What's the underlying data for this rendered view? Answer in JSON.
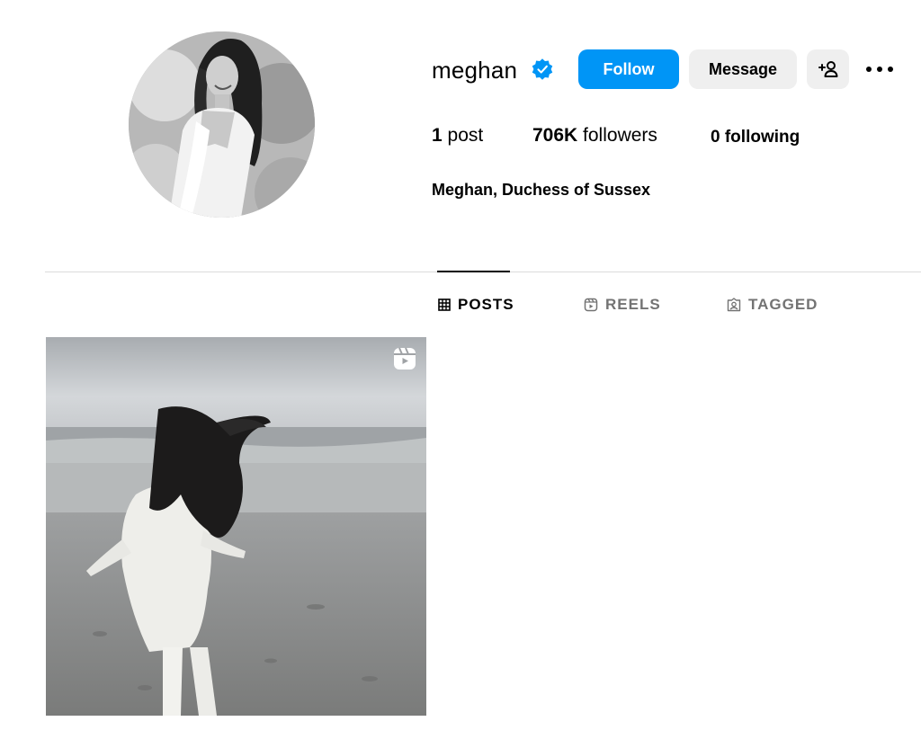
{
  "profile": {
    "username": "meghan",
    "verified": true,
    "full_name": "Meghan, Duchess of Sussex",
    "avatar_icon": "profile-photo"
  },
  "actions": {
    "follow_label": "Follow",
    "message_label": "Message",
    "add_user_icon": "person-plus-icon",
    "more_icon": "ellipsis-icon"
  },
  "stats": {
    "posts_count": "1",
    "posts_label": "post",
    "followers_count": "706K",
    "followers_label": "followers",
    "following_count": "0",
    "following_label": "following"
  },
  "tabs": [
    {
      "label": "POSTS",
      "icon": "grid-icon",
      "active": true
    },
    {
      "label": "REELS",
      "icon": "reels-icon",
      "active": false
    },
    {
      "label": "TAGGED",
      "icon": "tagged-icon",
      "active": false
    }
  ],
  "posts": [
    {
      "type": "reel",
      "badge_icon": "reels-icon"
    }
  ],
  "colors": {
    "accent": "#0095f6",
    "secondary_button": "#efefef",
    "muted_text": "#737373",
    "divider": "#dbdbdb",
    "verified_badge": "#0095f6"
  }
}
